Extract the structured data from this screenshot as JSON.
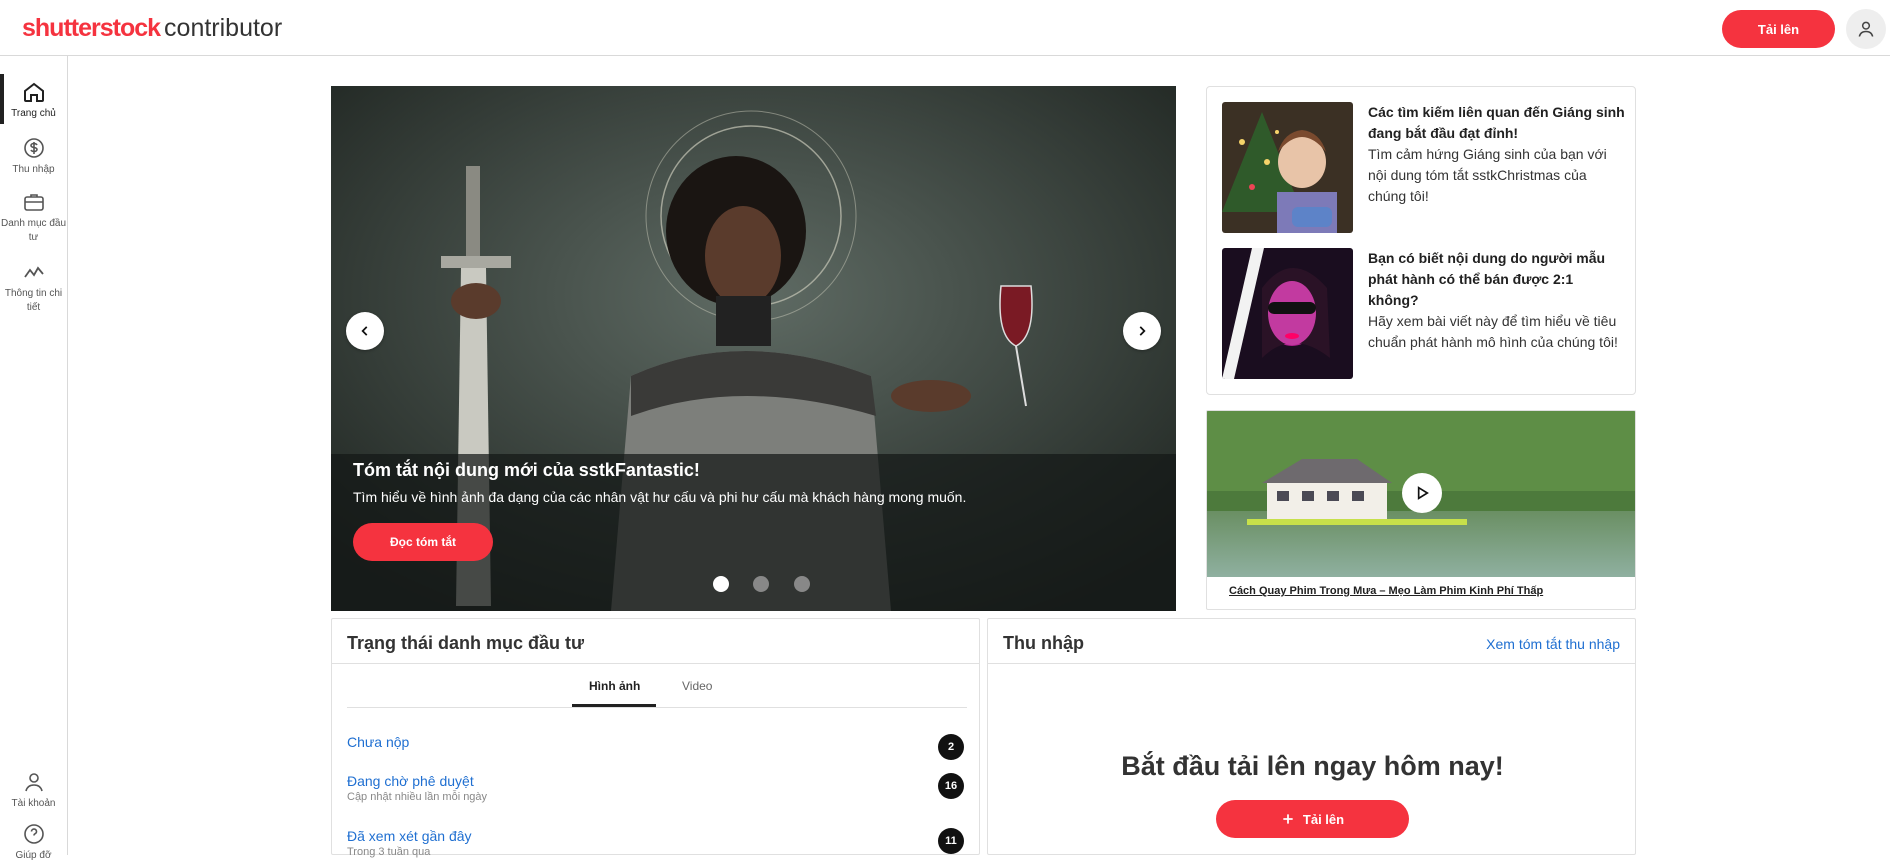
{
  "brand": {
    "name": "shutterstock",
    "sub": "contributor"
  },
  "header": {
    "upload_label": "Tải lên",
    "avatar_icon": "user-icon"
  },
  "nav": {
    "top": [
      {
        "label": "Trang chủ",
        "icon": "home-icon"
      },
      {
        "label": "Thu nhập",
        "icon": "dollar-icon"
      },
      {
        "label": "Danh mục đầu tư",
        "icon": "briefcase-icon"
      },
      {
        "label": "Thông tin chi tiết",
        "icon": "insights-icon"
      }
    ],
    "bottom": [
      {
        "label": "Tài khoản",
        "icon": "user-icon"
      },
      {
        "label": "Giúp đỡ",
        "icon": "help-icon"
      }
    ]
  },
  "hero": {
    "title": "Tóm tắt nội dung mới của sstkFantastic!",
    "description": "Tìm hiểu về hình ảnh đa dạng của các nhân vật hư cấu và phi hư cấu mà khách hàng mong muốn.",
    "button": "Đọc tóm tắt",
    "slides_total": 3,
    "slide_active": 1
  },
  "news": [
    {
      "title": "Các tìm kiếm liên quan đến Giáng sinh đang bắt đầu đạt đỉnh!",
      "body": "Tìm cảm hứng Giáng sinh của bạn với nội dung tóm tắt sstkChristmas của chúng tôi!"
    },
    {
      "title": "Bạn có biết nội dung do người mẫu phát hành có thể bán được 2:1 không?",
      "body": "Hãy xem bài viết này để tìm hiểu về tiêu chuẩn phát hành mô hình của chúng tôi!"
    }
  ],
  "video": {
    "link": "Cách Quay Phim Trong Mưa – Mẹo Làm Phim Kinh Phí Thấp"
  },
  "portfolio": {
    "title": "Trạng thái danh mục đầu tư",
    "tabs": [
      "Hình ảnh",
      "Video"
    ],
    "statuses": [
      {
        "label": "Chưa nộp",
        "sub": "",
        "count": "2"
      },
      {
        "label": "Đang chờ phê duyệt",
        "sub": "Cập nhật nhiều lần mỗi ngày",
        "count": "16"
      },
      {
        "label": "Đã xem xét gần đây",
        "sub": "Trong 3 tuần qua",
        "count": "11"
      }
    ]
  },
  "earnings": {
    "title": "Thu nhập",
    "summary_link": "Xem tóm tắt thu nhập",
    "cta": "Bắt đầu tải lên ngay hôm nay!",
    "upload_label": "Tải lên"
  },
  "colors": {
    "accent": "#f5333f",
    "link": "#1f6fd1"
  }
}
